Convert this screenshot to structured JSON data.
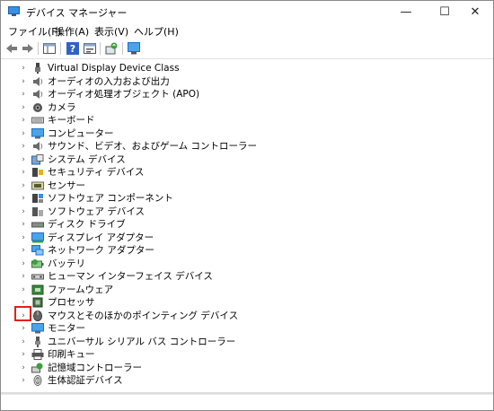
{
  "window": {
    "title": "デバイス マネージャー",
    "minimize": "—",
    "maximize": "☐",
    "close": "✕"
  },
  "menu": [
    {
      "label": "ファイル(F)"
    },
    {
      "label": "操作(A)"
    },
    {
      "label": "表示(V)"
    },
    {
      "label": "ヘルプ(H)"
    }
  ],
  "tree": {
    "chevron": "›",
    "items": [
      {
        "label": "Virtual Display Device Class",
        "icon": "plug-icon"
      },
      {
        "label": "オーディオの入力および出力",
        "icon": "speaker-icon"
      },
      {
        "label": "オーディオ処理オブジェクト (APO)",
        "icon": "speaker-icon"
      },
      {
        "label": "カメラ",
        "icon": "camera-icon"
      },
      {
        "label": "キーボード",
        "icon": "keyboard-icon"
      },
      {
        "label": "コンピューター",
        "icon": "monitor-icon"
      },
      {
        "label": "サウンド、ビデオ、およびゲーム コントローラー",
        "icon": "speaker-icon"
      },
      {
        "label": "システム デバイス",
        "icon": "system-icon"
      },
      {
        "label": "セキュリティ デバイス",
        "icon": "security-icon"
      },
      {
        "label": "センサー",
        "icon": "sensor-icon"
      },
      {
        "label": "ソフトウェア コンポーネント",
        "icon": "software-component-icon"
      },
      {
        "label": "ソフトウェア デバイス",
        "icon": "software-device-icon"
      },
      {
        "label": "ディスク ドライブ",
        "icon": "disk-drive-icon"
      },
      {
        "label": "ディスプレイ アダプター",
        "icon": "display-adapter-icon"
      },
      {
        "label": "ネットワーク アダプター",
        "icon": "network-icon"
      },
      {
        "label": "バッテリ",
        "icon": "battery-icon"
      },
      {
        "label": "ヒューマン インターフェイス デバイス",
        "icon": "hid-icon"
      },
      {
        "label": "ファームウェア",
        "icon": "firmware-icon"
      },
      {
        "label": "プロセッサ",
        "icon": "processor-icon"
      },
      {
        "label": "マウスとそのほかのポインティング デバイス",
        "icon": "mouse-icon"
      },
      {
        "label": "モニター",
        "icon": "monitor-icon"
      },
      {
        "label": "ユニバーサル シリアル バス コントローラー",
        "icon": "usb-icon"
      },
      {
        "label": "印刷キュー",
        "icon": "printer-icon"
      },
      {
        "label": "記憶域コントローラー",
        "icon": "storage-icon"
      },
      {
        "label": "生体認証デバイス",
        "icon": "biometric-icon"
      }
    ]
  },
  "colors": {
    "highlight": "#e0201e",
    "accent": "#1e6ec8"
  }
}
